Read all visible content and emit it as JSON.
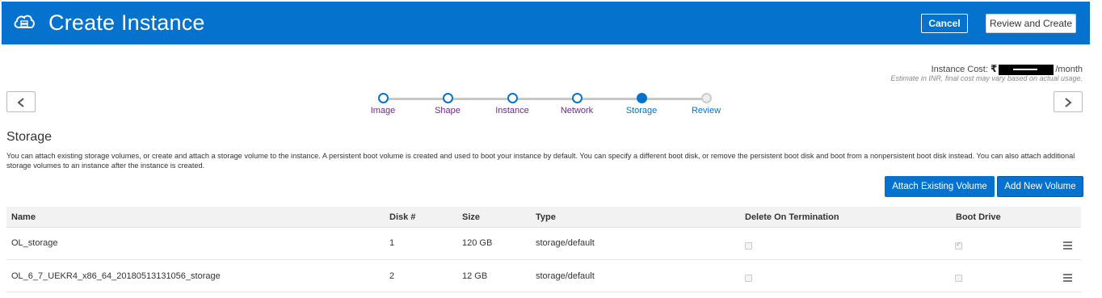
{
  "header": {
    "title": "Create Instance",
    "logo_icon": "cloud-server-icon",
    "cancel_label": "Cancel",
    "review_label": "Review and Create",
    "bg_color": "#0572ce"
  },
  "cost": {
    "label": "Instance Cost:",
    "currency": "₹",
    "per": "/month",
    "estimate_note": "Estimate in INR, final cost may vary based on actual usage."
  },
  "train": {
    "steps": [
      {
        "label": "Image",
        "state": "visited"
      },
      {
        "label": "Shape",
        "state": "visited"
      },
      {
        "label": "Instance",
        "state": "visited"
      },
      {
        "label": "Network",
        "state": "visited"
      },
      {
        "label": "Storage",
        "state": "current"
      },
      {
        "label": "Review",
        "state": "future"
      }
    ]
  },
  "section": {
    "title": "Storage",
    "description": "You can attach existing storage volumes, or create and attach a storage volume to the instance. A persistent boot volume is created and used to boot your instance by default. You can specify a different boot disk, or remove the persistent boot disk and boot from a nonpersistent boot disk instead. You can also attach additional storage volumes to an instance after the instance is created.",
    "attach_label": "Attach Existing Volume",
    "add_label": "Add New Volume"
  },
  "table": {
    "headers": {
      "name": "Name",
      "disk": "Disk #",
      "size": "Size",
      "type": "Type",
      "delete": "Delete On Termination",
      "boot": "Boot Drive"
    },
    "rows": [
      {
        "name": "OL_storage",
        "disk": "1",
        "size": "120 GB",
        "type": "storage/default",
        "delete": false,
        "boot": true
      },
      {
        "name": "OL_6_7_UEKR4_x86_64_20180513131056_storage",
        "disk": "2",
        "size": "12 GB",
        "type": "storage/default",
        "delete": false,
        "boot": false
      }
    ]
  }
}
